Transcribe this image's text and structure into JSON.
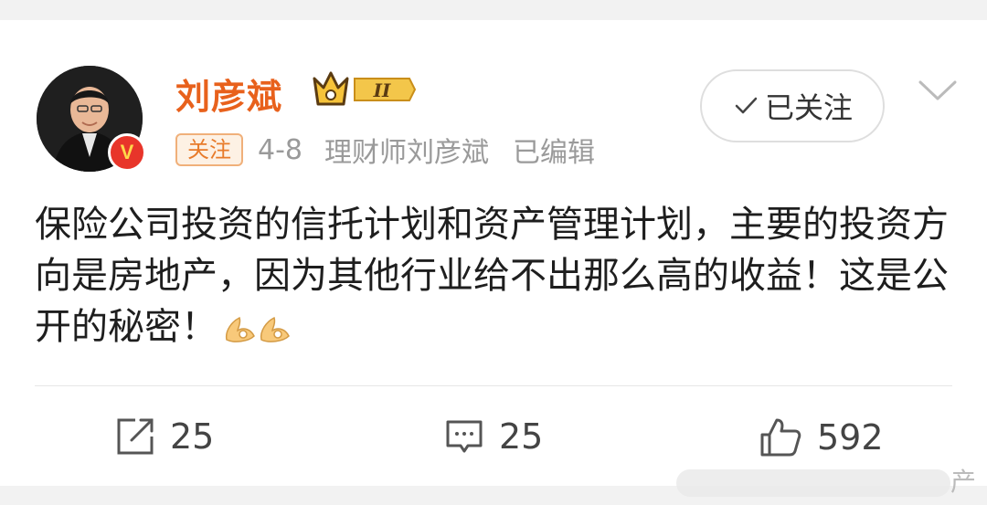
{
  "user": {
    "name": "刘彦斌",
    "level_badge": "II",
    "verified_badge": "V",
    "follow_tag": "关注",
    "date": "4-8",
    "source": "理财师刘彦斌",
    "edited": "已编辑",
    "followed_label": "已关注"
  },
  "post": {
    "text": "保险公司投资的信托计划和资产管理计划，主要的投资方向是房地产，因为其他行业给不出那么高的收益！这是公开的秘密！"
  },
  "actions": {
    "repost_count": "25",
    "comment_count": "25",
    "like_count": "592"
  },
  "watermark": {
    "partial_text": "产"
  },
  "colors": {
    "username": "#e8611c",
    "tag_border": "#f0b07a",
    "verified": "#e8352a"
  }
}
